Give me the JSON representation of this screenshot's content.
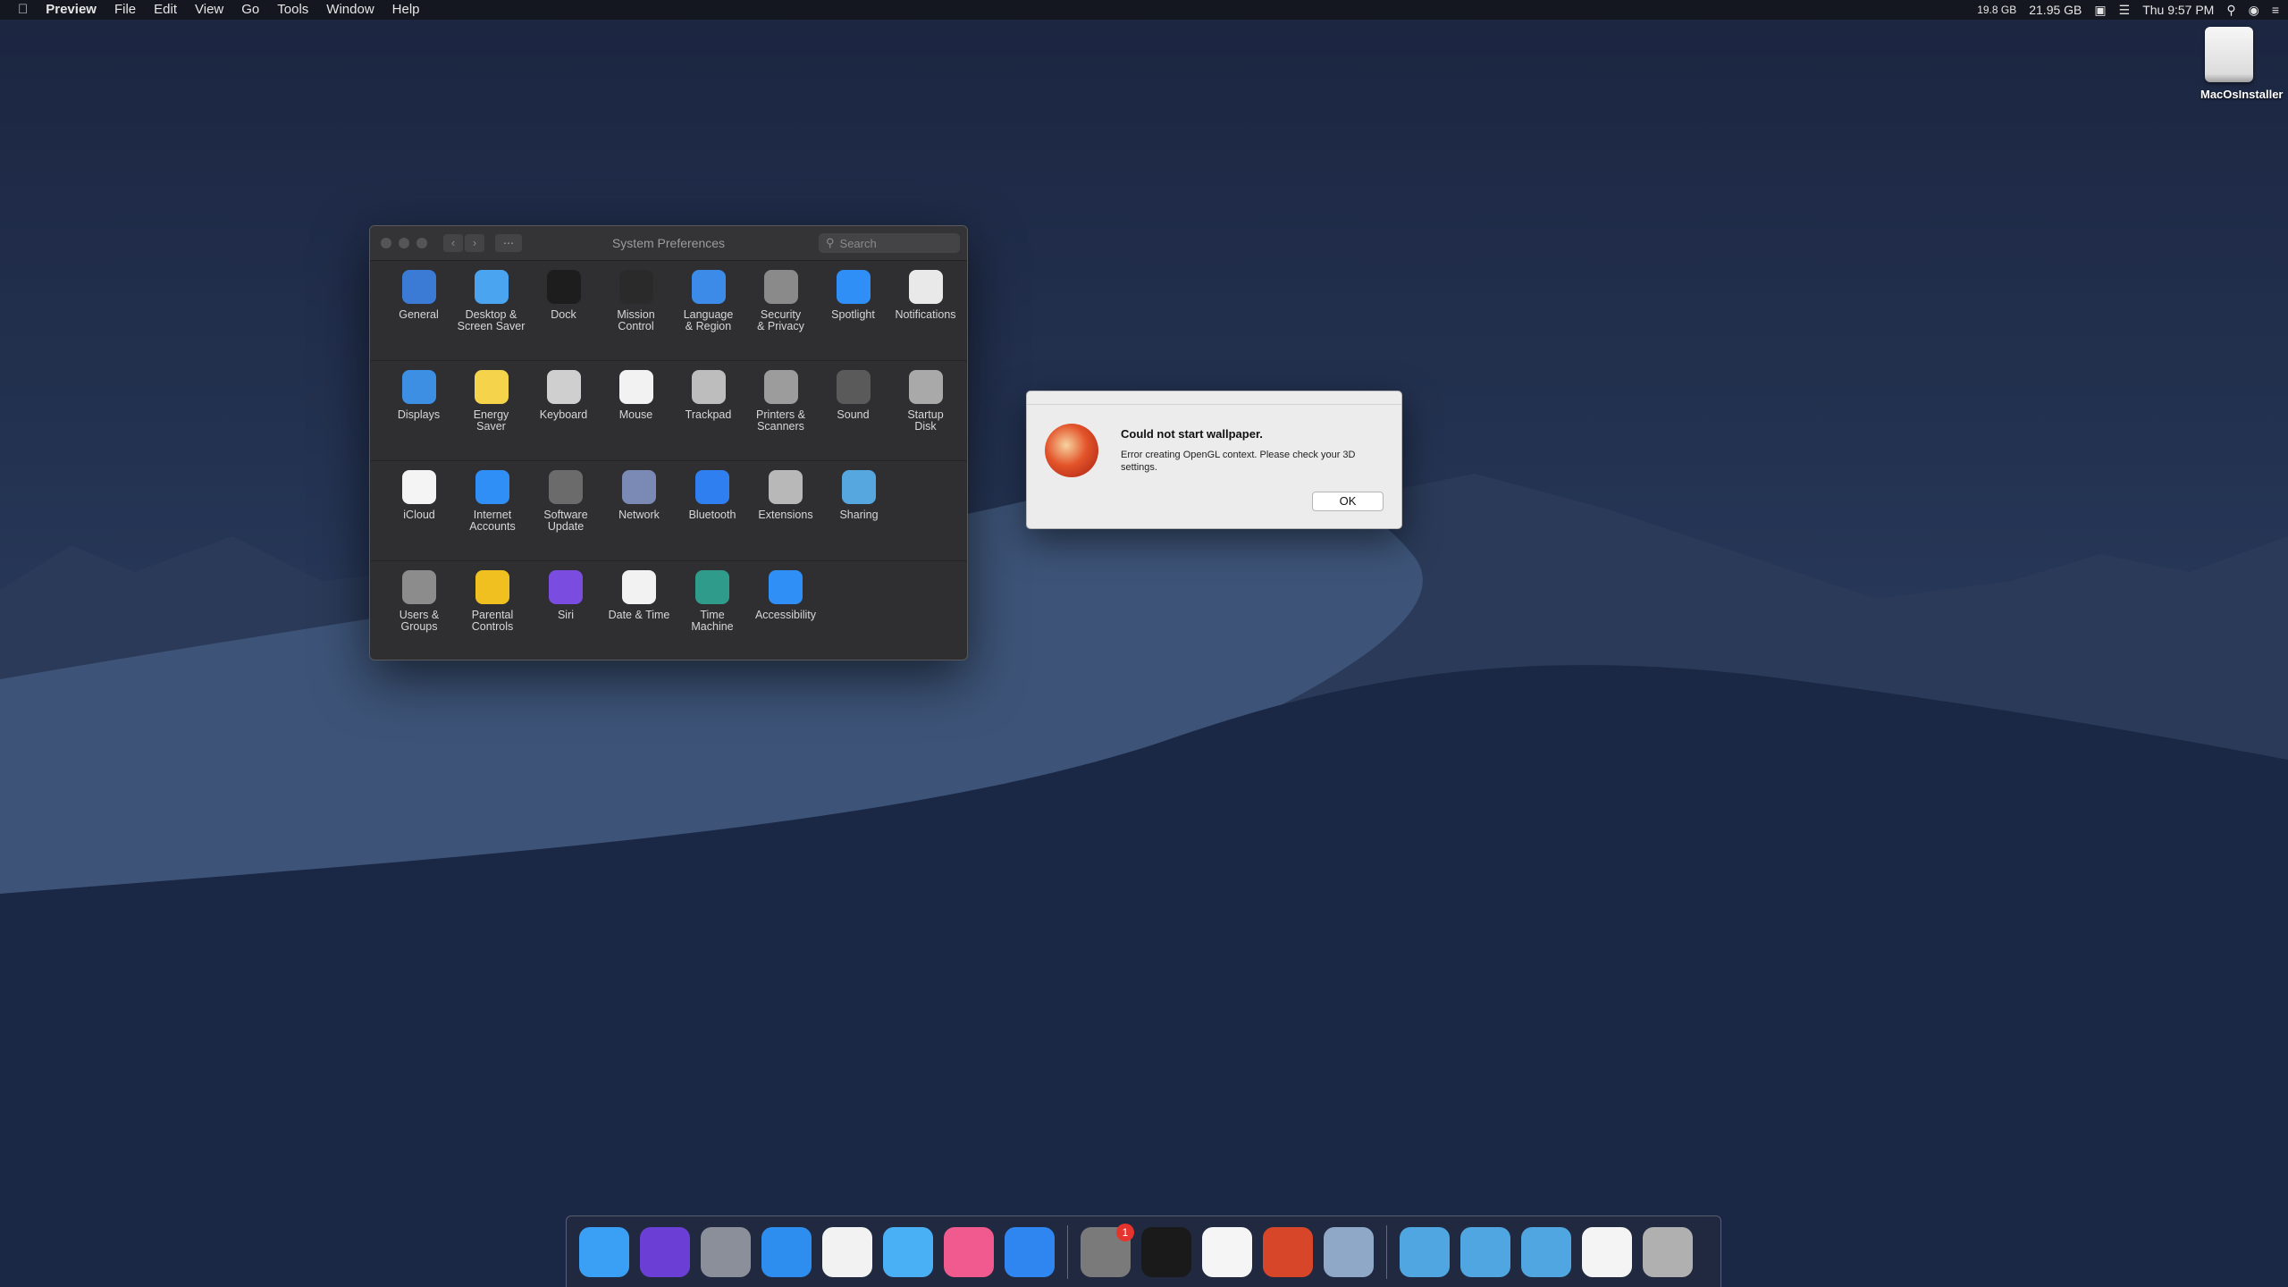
{
  "menubar": {
    "apple_glyph": "",
    "app_name": "Preview",
    "items": [
      "File",
      "Edit",
      "View",
      "Go",
      "Tools",
      "Window",
      "Help"
    ],
    "status": {
      "mem": "19.8 GB",
      "disk": "21.95 GB",
      "clock": "Thu 9:57 PM"
    }
  },
  "desktop": {
    "disk_label": "MacOsInstaller"
  },
  "syspref": {
    "title": "System Preferences",
    "search_placeholder": "Search",
    "rows": [
      [
        {
          "label": "General",
          "icon": "general-icon",
          "color": "#3b7bd6"
        },
        {
          "label": "Desktop &\nScreen Saver",
          "icon": "desktop-icon",
          "color": "#4aa4f0"
        },
        {
          "label": "Dock",
          "icon": "dock-icon",
          "color": "#1d1d1d"
        },
        {
          "label": "Mission\nControl",
          "icon": "mission-control-icon",
          "color": "#2a2a2a"
        },
        {
          "label": "Language\n& Region",
          "icon": "language-icon",
          "color": "#3d8be8"
        },
        {
          "label": "Security\n& Privacy",
          "icon": "security-icon",
          "color": "#8a8a8a"
        },
        {
          "label": "Spotlight",
          "icon": "spotlight-icon",
          "color": "#2f8ff7"
        },
        {
          "label": "Notifications",
          "icon": "notifications-icon",
          "color": "#e9e9e9"
        }
      ],
      [
        {
          "label": "Displays",
          "icon": "displays-icon",
          "color": "#3c8fe2"
        },
        {
          "label": "Energy\nSaver",
          "icon": "energy-icon",
          "color": "#f5d34a"
        },
        {
          "label": "Keyboard",
          "icon": "keyboard-icon",
          "color": "#cfcfcf"
        },
        {
          "label": "Mouse",
          "icon": "mouse-icon",
          "color": "#f2f2f2"
        },
        {
          "label": "Trackpad",
          "icon": "trackpad-icon",
          "color": "#bdbdbd"
        },
        {
          "label": "Printers &\nScanners",
          "icon": "printer-icon",
          "color": "#9c9c9c"
        },
        {
          "label": "Sound",
          "icon": "sound-icon",
          "color": "#5a5a5a"
        },
        {
          "label": "Startup\nDisk",
          "icon": "startup-disk-icon",
          "color": "#a9a9a9"
        }
      ],
      [
        {
          "label": "iCloud",
          "icon": "icloud-icon",
          "color": "#f4f4f4"
        },
        {
          "label": "Internet\nAccounts",
          "icon": "internet-accounts-icon",
          "color": "#2f8ff7"
        },
        {
          "label": "Software\nUpdate",
          "icon": "software-update-icon",
          "color": "#6b6b6b"
        },
        {
          "label": "Network",
          "icon": "network-icon",
          "color": "#7b89b5"
        },
        {
          "label": "Bluetooth",
          "icon": "bluetooth-icon",
          "color": "#2f7ff0"
        },
        {
          "label": "Extensions",
          "icon": "extensions-icon",
          "color": "#b8b8b8"
        },
        {
          "label": "Sharing",
          "icon": "sharing-icon",
          "color": "#56a7e0"
        }
      ],
      [
        {
          "label": "Users &\nGroups",
          "icon": "users-icon",
          "color": "#8c8c8c"
        },
        {
          "label": "Parental\nControls",
          "icon": "parental-icon",
          "color": "#f0c020"
        },
        {
          "label": "Siri",
          "icon": "siri-icon",
          "color": "#7a4de0"
        },
        {
          "label": "Date & Time",
          "icon": "date-time-icon",
          "color": "#f2f2f2"
        },
        {
          "label": "Time\nMachine",
          "icon": "time-machine-icon",
          "color": "#2f9b8a"
        },
        {
          "label": "Accessibility",
          "icon": "accessibility-icon",
          "color": "#2f8ff7"
        }
      ]
    ]
  },
  "alert": {
    "title": "Could not start wallpaper.",
    "message": "Error creating OpenGL context. Please check your 3D settings.",
    "ok_label": "OK"
  },
  "dock": {
    "apps": [
      {
        "name": "finder-icon",
        "color": "#3aa0f5"
      },
      {
        "name": "siri-icon",
        "color": "#6b3fd6"
      },
      {
        "name": "launchpad-icon",
        "color": "#8a8f9a"
      },
      {
        "name": "safari-icon",
        "color": "#2e8ef0"
      },
      {
        "name": "photos-icon",
        "color": "#f2f2f2"
      },
      {
        "name": "messages-icon",
        "color": "#4ab0f5"
      },
      {
        "name": "itunes-icon",
        "color": "#f05a8e"
      },
      {
        "name": "app-store-icon",
        "color": "#2f86f0"
      }
    ],
    "running": [
      {
        "name": "system-preferences-icon",
        "color": "#7a7a7a",
        "badge": "1"
      },
      {
        "name": "terminal-icon",
        "color": "#1a1a1a",
        "badge": ""
      },
      {
        "name": "chrome-icon",
        "color": "#f5f5f5",
        "badge": ""
      },
      {
        "name": "wallpaper-app-icon",
        "color": "#d8462a",
        "badge": ""
      },
      {
        "name": "preview-icon",
        "color": "#8fa8c8",
        "badge": ""
      }
    ],
    "others": [
      {
        "name": "applications-folder-icon",
        "color": "#4fa6e0"
      },
      {
        "name": "documents-folder-icon",
        "color": "#4fa6e0"
      },
      {
        "name": "downloads-folder-icon",
        "color": "#4fa6e0"
      },
      {
        "name": "document-preview-icon",
        "color": "#f4f4f4"
      },
      {
        "name": "trash-icon",
        "color": "#b0b0b0"
      }
    ]
  }
}
